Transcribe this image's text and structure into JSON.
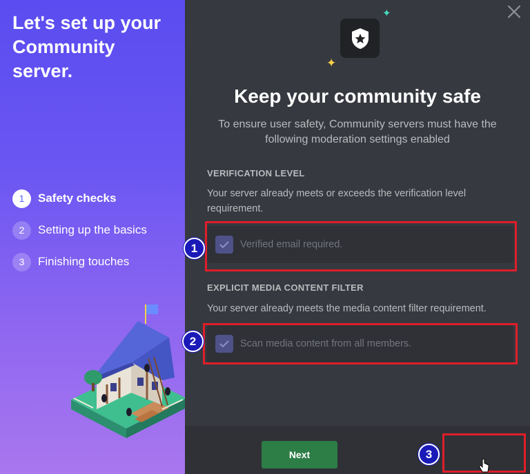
{
  "sidebar": {
    "title": "Let's set up your Community server.",
    "steps": [
      {
        "number": "1",
        "label": "Safety checks",
        "active": true
      },
      {
        "number": "2",
        "label": "Setting up the basics",
        "active": false
      },
      {
        "number": "3",
        "label": "Finishing touches",
        "active": false
      }
    ]
  },
  "dialog": {
    "close_icon": "close-icon",
    "header_icon": "shield-star-icon",
    "title": "Keep your community safe",
    "subtitle": "To ensure user safety, Community servers must have the following moderation settings enabled",
    "verification": {
      "heading": "VERIFICATION LEVEL",
      "description": "Your server already meets or exceeds the verification level requirement.",
      "checkbox_label": "Verified email required.",
      "checked": true
    },
    "media_filter": {
      "heading": "EXPLICIT MEDIA CONTENT FILTER",
      "description": "Your server already meets the media content filter requirement.",
      "checkbox_label": "Scan media content from all members.",
      "checked": true
    },
    "next_label": "Next"
  },
  "annotations": {
    "badge_1": "1",
    "badge_2": "2",
    "badge_3": "3",
    "highlight_color": "#e01e2a"
  },
  "colors": {
    "accent": "#5865f2",
    "success": "#2d7d46",
    "panel": "#36393f"
  }
}
